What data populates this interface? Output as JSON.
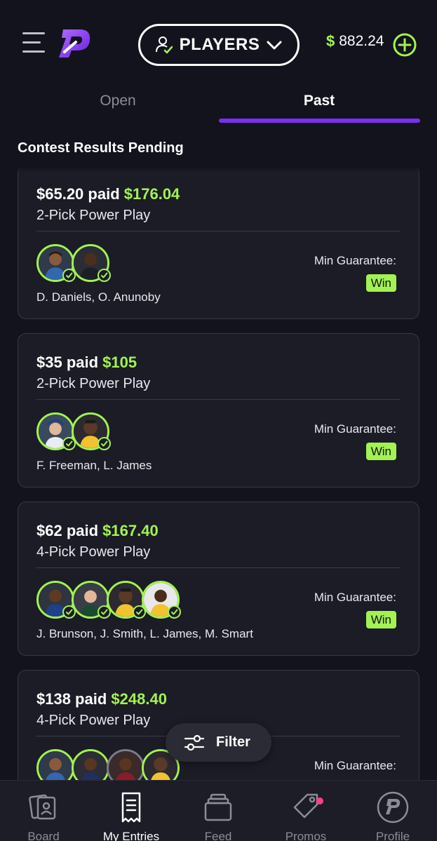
{
  "header": {
    "selector_label": "PLAYERS",
    "balance_symbol": "$",
    "balance_amount": "882.24"
  },
  "tabs": [
    {
      "label": "Open",
      "active": false
    },
    {
      "label": "Past",
      "active": true
    }
  ],
  "section_title": "Contest Results Pending",
  "cards": [
    {
      "paid": "$65.20 paid",
      "payout": "$176.04",
      "play_type": "2-Pick Power Play",
      "players": "D. Daniels, O. Anunoby",
      "guarantee_label": "Min Guarantee:",
      "guarantee_value": "Win"
    },
    {
      "paid": "$35 paid",
      "payout": "$105",
      "play_type": "2-Pick Power Play",
      "players": "F. Freeman, L. James",
      "guarantee_label": "Min Guarantee:",
      "guarantee_value": "Win"
    },
    {
      "paid": "$62 paid",
      "payout": "$167.40",
      "play_type": "4-Pick Power Play",
      "players": "J. Brunson, J. Smith, L. James, M. Smart",
      "guarantee_label": "Min Guarantee:",
      "guarantee_value": "Win"
    },
    {
      "paid": "$138 paid",
      "payout": "$248.40",
      "play_type": "4-Pick Power Play",
      "players": "",
      "guarantee_label": "Min Guarantee:",
      "guarantee_value": ""
    }
  ],
  "filter_label": "Filter",
  "nav": [
    {
      "label": "Board",
      "icon": "board-icon",
      "active": false
    },
    {
      "label": "My Entries",
      "icon": "entries-icon",
      "active": true
    },
    {
      "label": "Feed",
      "icon": "feed-icon",
      "active": false
    },
    {
      "label": "Promos",
      "icon": "promos-icon",
      "active": false
    },
    {
      "label": "Profile",
      "icon": "profile-icon",
      "active": false
    }
  ],
  "colors": {
    "background": "#12131c",
    "card": "#1b1c25",
    "accent_green": "#a3f252",
    "accent_purple": "#7a2ff0",
    "notification_dot": "#ff3d8a"
  }
}
